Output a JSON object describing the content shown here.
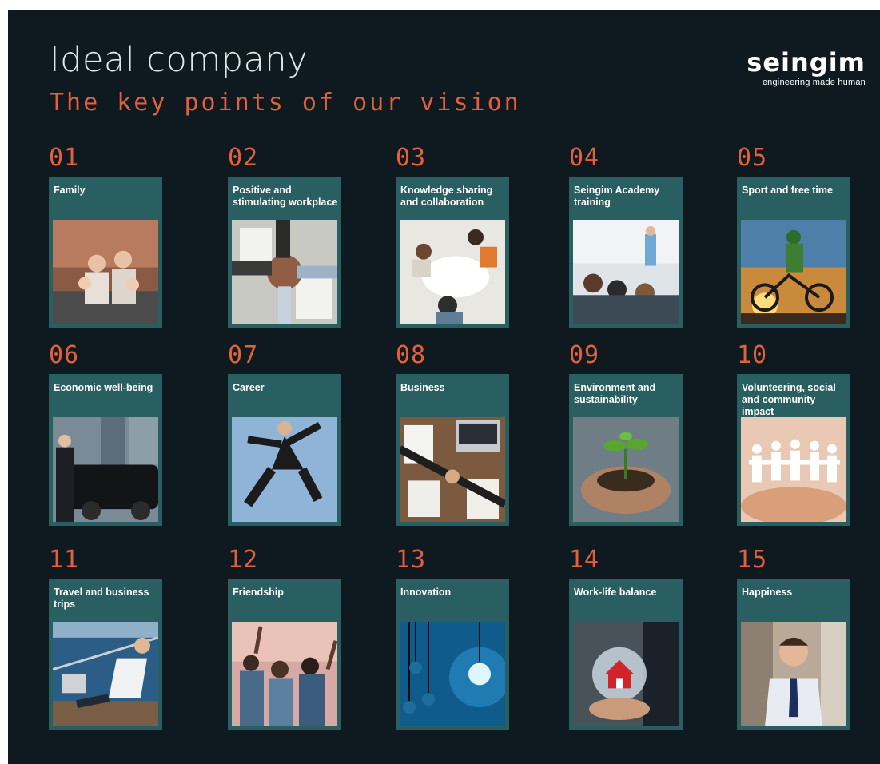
{
  "header": {
    "title": "Ideal company",
    "subtitle": "The key points of our vision",
    "logo_word": "seingim",
    "logo_tagline": "engineering made human"
  },
  "colors": {
    "background": "#0f1a20",
    "accent": "#e2613c",
    "card": "#2a5f62"
  },
  "points": [
    {
      "number": "01",
      "label": "Family",
      "photo": "family-photo"
    },
    {
      "number": "02",
      "label": "Positive and stimulating workplace",
      "photo": "fist-bump-photo"
    },
    {
      "number": "03",
      "label": "Knowledge sharing and collaboration",
      "photo": "meeting-table-photo"
    },
    {
      "number": "04",
      "label": "Seingim Academy training",
      "photo": "classroom-photo"
    },
    {
      "number": "05",
      "label": "Sport and free time",
      "photo": "cyclist-sunset-photo"
    },
    {
      "number": "06",
      "label": "Economic well-being",
      "photo": "luxury-car-photo"
    },
    {
      "number": "07",
      "label": "Career",
      "photo": "leaping-businessman-photo"
    },
    {
      "number": "08",
      "label": "Business",
      "photo": "handshake-desk-photo"
    },
    {
      "number": "09",
      "label": "Environment and sustainability",
      "photo": "seedling-hands-photo"
    },
    {
      "number": "10",
      "label": "Volunteering, social and community impact",
      "photo": "paper-people-hands-photo"
    },
    {
      "number": "11",
      "label": "Travel and business trips",
      "photo": "laptop-on-deck-photo"
    },
    {
      "number": "12",
      "label": "Friendship",
      "photo": "friends-sunset-photo"
    },
    {
      "number": "13",
      "label": "Innovation",
      "photo": "light-bulbs-photo"
    },
    {
      "number": "14",
      "label": "Work-life balance",
      "photo": "house-in-globe-photo"
    },
    {
      "number": "15",
      "label": "Happiness",
      "photo": "smiling-man-photo"
    }
  ]
}
